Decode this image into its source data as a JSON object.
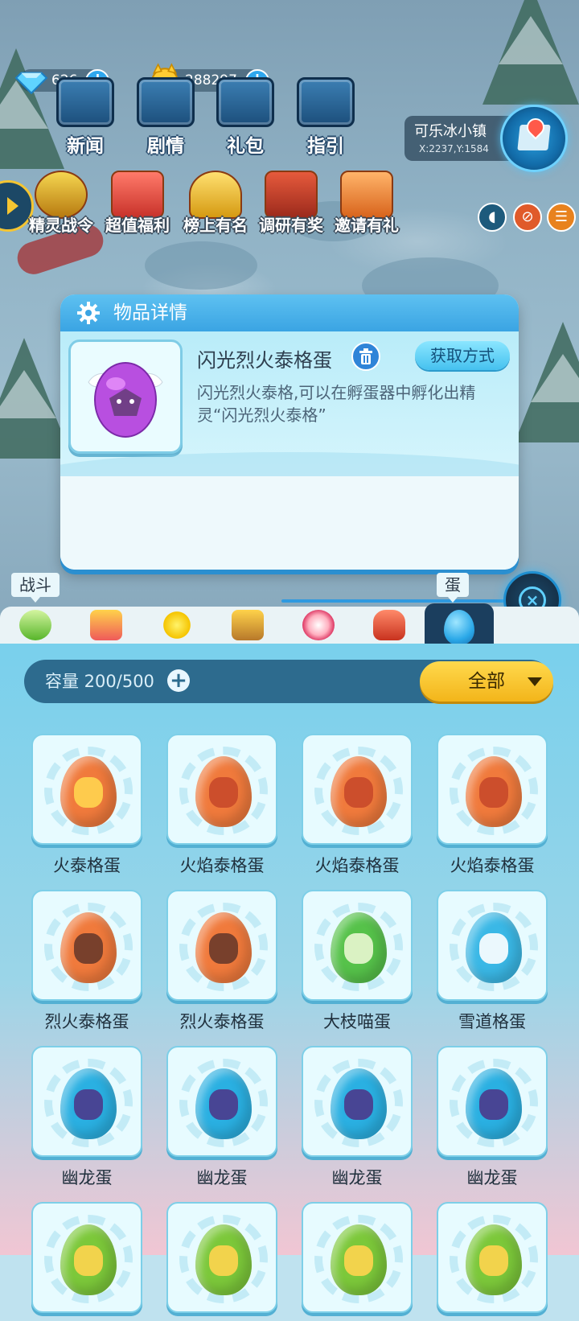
{
  "hud": {
    "gems": "626",
    "coins": "288297",
    "top_buttons": [
      {
        "label": "新闻",
        "icon": "news-board-icon"
      },
      {
        "label": "剧情",
        "icon": "story-machine-icon"
      },
      {
        "label": "礼包",
        "icon": "gift-box-icon"
      },
      {
        "label": "指引",
        "icon": "guide-machine-icon"
      }
    ],
    "location_name": "可乐冰小镇",
    "location_coords": "X:2237,Y:1584",
    "event_buttons": [
      {
        "label": "精灵战令",
        "icon": "battle-pass-icon"
      },
      {
        "label": "超值福利",
        "icon": "welfare-gift-icon"
      },
      {
        "label": "榜上有名",
        "icon": "trophy-icon"
      },
      {
        "label": "调研有奖",
        "icon": "survey-chest-icon"
      },
      {
        "label": "邀请有礼",
        "icon": "invite-gift-icon"
      }
    ]
  },
  "detail": {
    "header": "物品详情",
    "title": "闪光烈火泰格蛋",
    "obtain_label": "获取方式",
    "description": "闪光烈火泰格,可以在孵蛋器中孵化出精灵“闪光烈火泰格”"
  },
  "tabs": {
    "battle_tag": "战斗",
    "active_tag": "蛋",
    "items": [
      "battery-icon",
      "block-items-icon",
      "star-wand-icon",
      "crown-tray-icon",
      "dress-icon",
      "rocking-horse-icon",
      "egg-icon"
    ]
  },
  "inventory": {
    "capacity_label": "容量 200/500",
    "filter": "全部",
    "slots": [
      {
        "name": "火泰格蛋",
        "egg": "#f07a3c",
        "face": "#ffd44f"
      },
      {
        "name": "火焰泰格蛋",
        "egg": "#f07a3c",
        "face": "#c8492a"
      },
      {
        "name": "火焰泰格蛋",
        "egg": "#f07a3c",
        "face": "#c8492a"
      },
      {
        "name": "火焰泰格蛋",
        "egg": "#f07a3c",
        "face": "#c8492a"
      },
      {
        "name": "烈火泰格蛋",
        "egg": "#f07a3c",
        "face": "#6a3a2a"
      },
      {
        "name": "烈火泰格蛋",
        "egg": "#f07a3c",
        "face": "#6a3a2a"
      },
      {
        "name": "大枝喵蛋",
        "egg": "#56c24a",
        "face": "#e9f7d0"
      },
      {
        "name": "雪道格蛋",
        "egg": "#3ab8e6",
        "face": "#ffffff"
      },
      {
        "name": "幽龙蛋",
        "egg": "#2ab0e2",
        "face": "#4b3a8c"
      },
      {
        "name": "幽龙蛋",
        "egg": "#2ab0e2",
        "face": "#4b3a8c"
      },
      {
        "name": "幽龙蛋",
        "egg": "#2ab0e2",
        "face": "#4b3a8c"
      },
      {
        "name": "幽龙蛋",
        "egg": "#2ab0e2",
        "face": "#4b3a8c"
      },
      {
        "name": "",
        "egg": "#7cc83a",
        "face": "#ffd44f"
      },
      {
        "name": "",
        "egg": "#7cc83a",
        "face": "#ffd44f"
      },
      {
        "name": "",
        "egg": "#7cc83a",
        "face": "#ffd44f"
      },
      {
        "name": "",
        "egg": "#7cc83a",
        "face": "#ffd44f"
      }
    ]
  },
  "colors": {
    "accent": "#3aa4e3",
    "filter_yellow": "#f3b51a",
    "shiny_egg": "#b84fe0"
  }
}
